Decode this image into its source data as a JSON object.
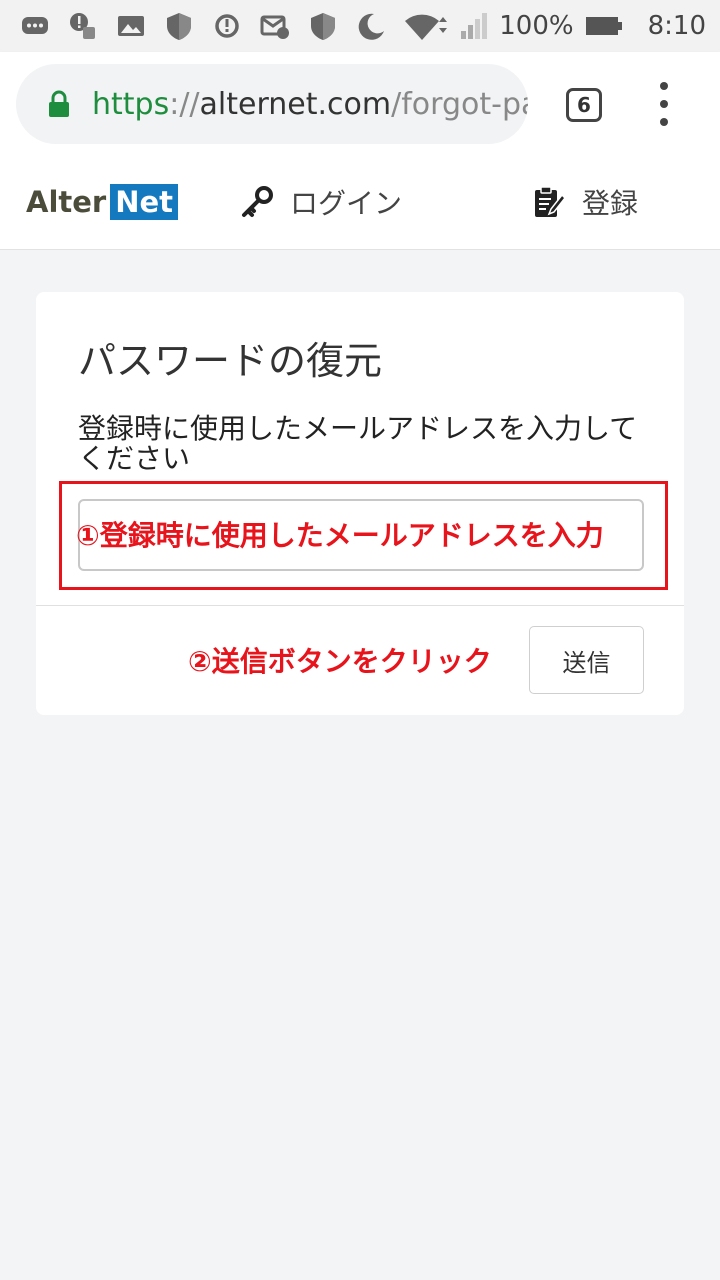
{
  "status_bar": {
    "battery": "100%",
    "time": "8:10",
    "left_icons": [
      "chat-icon",
      "alert-robot-icon",
      "image-icon",
      "shield-icon",
      "sync-icon",
      "mail-alert-icon",
      "shield-icon",
      "moon-icon"
    ],
    "right_icons": [
      "wifi-icon",
      "signal-icon",
      "battery-icon"
    ]
  },
  "browser": {
    "url_scheme": "https",
    "url_sep": "://",
    "url_host": "alternet.com",
    "url_path": "/forgot-pa",
    "tab_count": "6"
  },
  "site": {
    "logo_alter": "Alter",
    "logo_net": "Net",
    "nav_login": "ログイン",
    "nav_register": "登録"
  },
  "card": {
    "title": "パスワードの復元",
    "description": "登録時に使用したメールアドレスを入力してください",
    "email_value": "",
    "annotation_1": "①登録時に使用したメールアドレスを入力",
    "annotation_2": "②送信ボタンをクリック",
    "submit_label": "送信"
  },
  "colors": {
    "annotation_red": "#e8141c",
    "logo_blue": "#1479bf",
    "lock_green": "#1e8e3e"
  }
}
